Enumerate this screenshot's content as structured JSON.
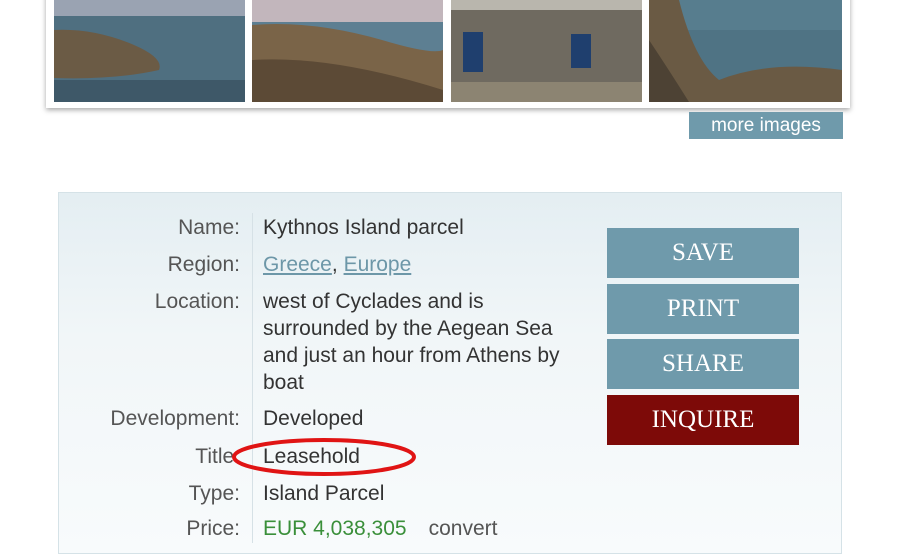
{
  "gallery": {
    "thumbnails": [
      "coast-thumbnail-1",
      "coast-thumbnail-2",
      "stone-house-thumbnail",
      "coast-thumbnail-4"
    ],
    "more_images_label": "more images"
  },
  "property": {
    "name_label": "Name:",
    "name_value": "Kythnos Island parcel",
    "region_label": "Region:",
    "region_links": [
      "Greece",
      "Europe"
    ],
    "region_separator": ",",
    "location_label": "Location:",
    "location_value": "west of Cyclades and is surrounded by the Aegean Sea and just an hour from Athens by boat",
    "development_label": "Development:",
    "development_value": "Developed",
    "title_label": "Title:",
    "title_value": "Leasehold",
    "type_label": "Type:",
    "type_value": "Island Parcel",
    "price_label": "Price:",
    "price_value": "EUR 4,038,305",
    "convert_label": "convert"
  },
  "actions": {
    "save": "SAVE",
    "print": "PRINT",
    "share": "SHARE",
    "inquire": "INQUIRE"
  },
  "colors": {
    "accent": "#6f9aab",
    "inquire": "#7d0a08",
    "price": "#3a8f3a",
    "highlight_circle": "#e01414"
  }
}
